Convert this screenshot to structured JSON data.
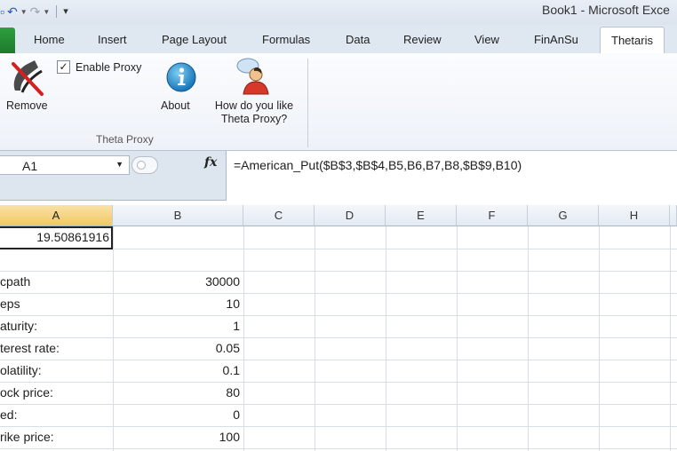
{
  "window": {
    "title": "Book1 - Microsoft Exce"
  },
  "ribbon": {
    "tabs": [
      "Home",
      "Insert",
      "Page Layout",
      "Formulas",
      "Data",
      "Review",
      "View",
      "FinAnSu",
      "Thetaris"
    ],
    "active_tab": "Thetaris",
    "buttons": {
      "remove": "Remove",
      "about": "About",
      "feedback_line1": "How do you like",
      "feedback_line2": "Theta Proxy?"
    },
    "enable_proxy_label": "Enable Proxy",
    "enable_proxy_checked": true,
    "checkmark": "✓",
    "group_label": "Theta Proxy"
  },
  "formula_bar": {
    "name_box": "A1",
    "fx_label": "fx",
    "formula": "=American_Put($B$3,$B$4,B5,B6,B7,B8,$B$9,B10)"
  },
  "grid": {
    "columns": [
      "A",
      "B",
      "C",
      "D",
      "E",
      "F",
      "G",
      "H"
    ],
    "selected_column": "A",
    "rows": [
      {
        "a": "19.50861916",
        "b": ""
      },
      {
        "a": "",
        "b": ""
      },
      {
        "a": "cpath",
        "b": "30000"
      },
      {
        "a": "eps",
        "b": "10"
      },
      {
        "a": "aturity:",
        "b": "1"
      },
      {
        "a": "terest rate:",
        "b": "0.05"
      },
      {
        "a": "olatility:",
        "b": "0.1"
      },
      {
        "a": "ock price:",
        "b": "80"
      },
      {
        "a": "ed:",
        "b": "0"
      },
      {
        "a": "rike price:",
        "b": "100"
      }
    ]
  }
}
